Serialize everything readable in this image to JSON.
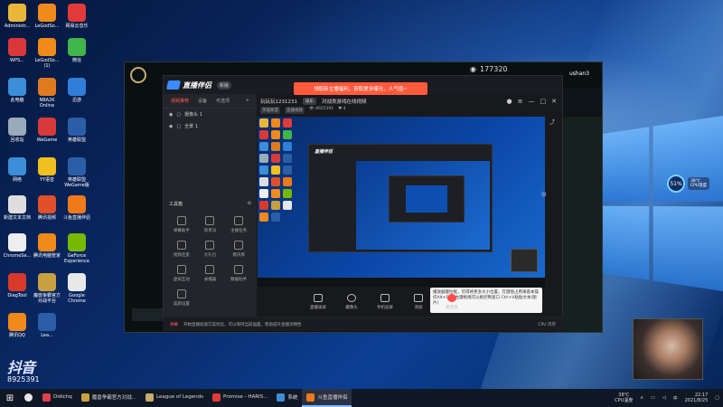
{
  "desktop": {
    "icons": [
      {
        "label": "Administr...",
        "color": "#e8b73a"
      },
      {
        "label": "LeGodSo...",
        "color": "#f08a1a"
      },
      {
        "label": "网易云音乐",
        "color": "#e23a3a"
      },
      {
        "label": "WPS...",
        "color": "#d8383a"
      },
      {
        "label": "LeGodSo... (1)",
        "color": "#f08a1a"
      },
      {
        "label": "微信",
        "color": "#3fb54a"
      },
      {
        "label": "此电脑",
        "color": "#3b8ed8"
      },
      {
        "label": "NBA2K Online",
        "color": "#e07a1f"
      },
      {
        "label": "迅游",
        "color": "#2f7ed8"
      },
      {
        "label": "回收站",
        "color": "#9ab"
      },
      {
        "label": "WeGame",
        "color": "#d83a3a"
      },
      {
        "label": "英雄联盟",
        "color": "#2a5fa8"
      },
      {
        "label": "网络",
        "color": "#3b8ed8"
      },
      {
        "label": "YY语音",
        "color": "#f0c020"
      },
      {
        "label": "英雄联盟 WeGame版",
        "color": "#2a5fa8"
      },
      {
        "label": "新建文本文档",
        "color": "#ddd"
      },
      {
        "label": "腾讯视频",
        "color": "#e0502a"
      },
      {
        "label": "斗鱼直播伴侣",
        "color": "#f07a1a"
      },
      {
        "label": "ChromeSe...",
        "color": "#eee"
      },
      {
        "label": "腾讯电脑管家",
        "color": "#f08a1a"
      },
      {
        "label": "GeForce Experience",
        "color": "#76b900"
      },
      {
        "label": "DiagTool",
        "color": "#d83a2a"
      },
      {
        "label": "魔兽争霸官方对战平台",
        "color": "#c8a040"
      },
      {
        "label": "Google Chrome",
        "color": "#e8e8e8"
      },
      {
        "label": "腾讯QQ",
        "color": "#f08a1a"
      },
      {
        "label": "Lea...",
        "color": "#2a5fa8"
      }
    ]
  },
  "background_window": {
    "counter": "177320",
    "username": "ushan3"
  },
  "app": {
    "brand": "直播伴侣",
    "version_badge": "新版",
    "sidebar": {
      "tabs": [
        "视频推荐",
        "设备",
        "可选项"
      ],
      "active_tab": "视频推荐",
      "scenes": [
        {
          "label": "摄像头 1"
        },
        {
          "label": "全景 1"
        }
      ],
      "toolbox_title": "工具箱",
      "tools": [
        {
          "label": "弹幕助手"
        },
        {
          "label": "新贵派"
        },
        {
          "label": "主播任务"
        },
        {
          "label": "视频连麦"
        },
        {
          "label": "大礼包"
        },
        {
          "label": "模块库"
        },
        {
          "label": "虚拟互动"
        },
        {
          "label": "录播器"
        },
        {
          "label": "数据助手"
        },
        {
          "label": "美颜设置"
        }
      ]
    },
    "room": {
      "title": "玩玩玩1231231",
      "tag": "娱乐",
      "category": "对战类游戏在线视频",
      "sub_tags": [
        "英雄联盟",
        "直播视频"
      ],
      "viewers": "8925391",
      "likes": "4"
    },
    "alert": "领取新主播福利，获取更多曝光，人气值~",
    "preview": {
      "brand": "直播伴侣"
    },
    "tooltip": "播放器键拉框，可得将更多大小位置，在键盘占用来基本操作Alt+Shift左键拖拽可以拖控制窗口 Ctrl+V粘贴文本(图片)",
    "controls": [
      {
        "label": "直播录屏",
        "icon": "screen-icon"
      },
      {
        "label": "摄像头",
        "icon": "camera-icon"
      },
      {
        "label": "手机投屏",
        "icon": "phone-icon"
      },
      {
        "label": "添加",
        "icon": "plus-icon"
      },
      {
        "label": "麦克风",
        "icon": "mic-icon"
      }
    ],
    "status": {
      "warning": "弹幕",
      "text": "开始直播加速方案优化，可以保持当前画面，帮助提升直播流畅性",
      "metrics": "CPU  内存"
    }
  },
  "overlay": {
    "douyin_logo": "抖音",
    "douyin_number": "8925391"
  },
  "perf_widget": {
    "percent": "51%",
    "temp": "38℃",
    "temp_label": "CPU温度"
  },
  "taskbar": {
    "items": [
      {
        "label": "Didichq",
        "color": "#e04050",
        "active": false
      },
      {
        "label": "魔兽争霸官方对战...",
        "color": "#c8a040",
        "active": false
      },
      {
        "label": "League of Legends",
        "color": "#c8aa6e",
        "active": false
      },
      {
        "label": "Promise - HARIS...",
        "color": "#e03a3a",
        "active": false
      },
      {
        "label": "系统",
        "color": "#3b8ed8",
        "active": false
      },
      {
        "label": "斗鱼直播伴侣",
        "color": "#f07a1a",
        "active": true
      }
    ],
    "temp": "38℃",
    "temp_label": "CPU温度",
    "time": "22:17",
    "date": "2021/8/25"
  }
}
